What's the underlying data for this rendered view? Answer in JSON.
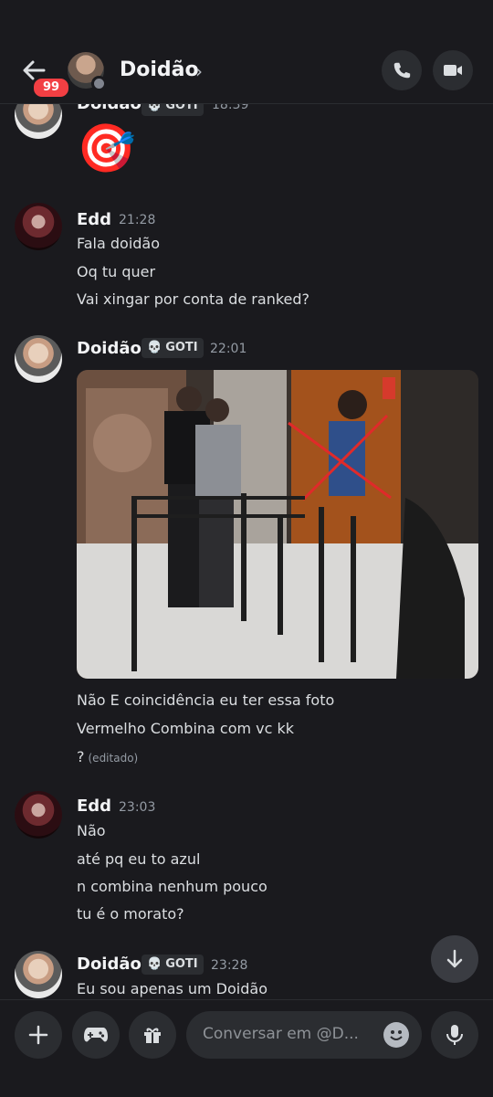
{
  "header": {
    "title": "Doidão",
    "unread_count": "99",
    "icons": [
      "back-arrow-icon",
      "chevron-right-icon",
      "voice-call-icon",
      "video-call-icon"
    ]
  },
  "messages": [
    {
      "author": "Doidão",
      "tag": "GOTI",
      "time": "18:39",
      "lines": [
        "🎯"
      ]
    },
    {
      "author": "Edd",
      "time": "21:28",
      "lines": [
        "Fala doidão",
        "Oq tu quer",
        "Vai xingar por conta de ranked?"
      ]
    },
    {
      "author": "Doidão",
      "tag": "GOTI",
      "time": "22:01",
      "lines": [
        "Não E coincidência eu ter essa foto",
        "Vermelho Combina com vc kk",
        "?"
      ],
      "edited_label": "(editado)"
    },
    {
      "author": "Edd",
      "time": "23:03",
      "lines": [
        "Não",
        "até pq eu to azul",
        "n combina nenhum pouco",
        "tu é o morato?"
      ]
    },
    {
      "author": "Doidão",
      "tag": "GOTI",
      "time": "23:28",
      "lines": [
        "Eu sou apenas um Doidão"
      ]
    }
  ],
  "composer": {
    "placeholder": "Conversar em @D...",
    "icons": [
      "plus-icon",
      "gamepad-icon",
      "gift-icon",
      "emoji-icon",
      "microphone-icon"
    ]
  },
  "colors": {
    "background": "#1a1a1e",
    "badge": "#f23f43",
    "text": "#dbdee1",
    "muted": "#949ba4"
  }
}
